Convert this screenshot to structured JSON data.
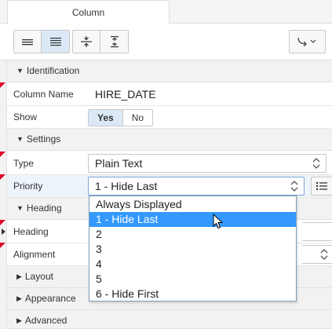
{
  "tabs": [
    {
      "label": "Column",
      "active": true
    }
  ],
  "toolbar": {
    "buttons": [
      {
        "icon": "rows-compact-icon",
        "active": false
      },
      {
        "icon": "rows-stretched-icon",
        "active": true
      },
      {
        "icon": "collapse-all-icon",
        "active": false
      },
      {
        "icon": "expand-all-icon",
        "active": false
      },
      {
        "icon": "go-to-group-icon",
        "active": false
      }
    ]
  },
  "sections": {
    "identification": "Identification",
    "settings": "Settings",
    "heading": "Heading",
    "layout": "Layout",
    "appearance": "Appearance",
    "advanced": "Advanced"
  },
  "properties": {
    "column_name": {
      "label": "Column Name",
      "value": "HIRE_DATE"
    },
    "show": {
      "label": "Show",
      "options": [
        "Yes",
        "No"
      ],
      "selected": "Yes"
    },
    "type": {
      "label": "Type",
      "value": "Plain Text"
    },
    "priority": {
      "label": "Priority",
      "value": "1 - Hide Last"
    },
    "heading": {
      "label": "Heading"
    },
    "alignment": {
      "label": "Alignment"
    }
  },
  "priority_dropdown": {
    "options": [
      "Always Displayed",
      "1 - Hide Last",
      "2",
      "3",
      "4",
      "5",
      "6 - Hide First"
    ],
    "highlighted": "1 - Hide Last"
  },
  "colors": {
    "accent": "#3399ff",
    "active_button": "#dbe8f6",
    "required_marker": "#e0002a",
    "section_bg": "#f2f2f2"
  }
}
